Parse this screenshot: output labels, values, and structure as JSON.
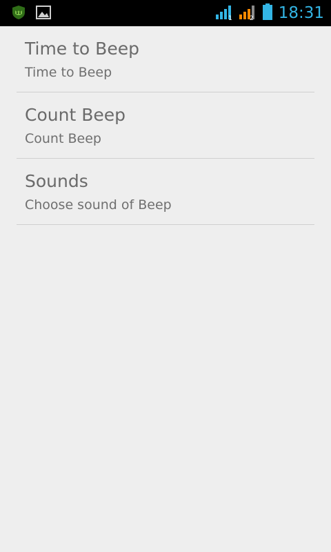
{
  "status_bar": {
    "time": "18:31",
    "icons": [
      "app-notification-icon",
      "image-notification-icon",
      "signal-sim1-icon",
      "signal-sim2-icon",
      "battery-icon"
    ],
    "sim1_badge": "1",
    "sim2_badge": "2",
    "colors": {
      "background": "#000000",
      "clock": "#33b5e5",
      "sim1_signal": "#33b5e5",
      "sim2_signal": "#ff8a00",
      "battery": "#33b5e5",
      "app_icon": "#3a7d1c"
    }
  },
  "preferences": [
    {
      "title": "Time to Beep",
      "summary": "Time to Beep"
    },
    {
      "title": "Count Beep",
      "summary": "Count Beep"
    },
    {
      "title": "Sounds",
      "summary": "Choose sound of Beep"
    }
  ],
  "colors": {
    "background": "#eeeeee",
    "divider": "#cfcfcf",
    "title_text": "#6a6a6a",
    "summary_text": "#6f6f6f"
  }
}
